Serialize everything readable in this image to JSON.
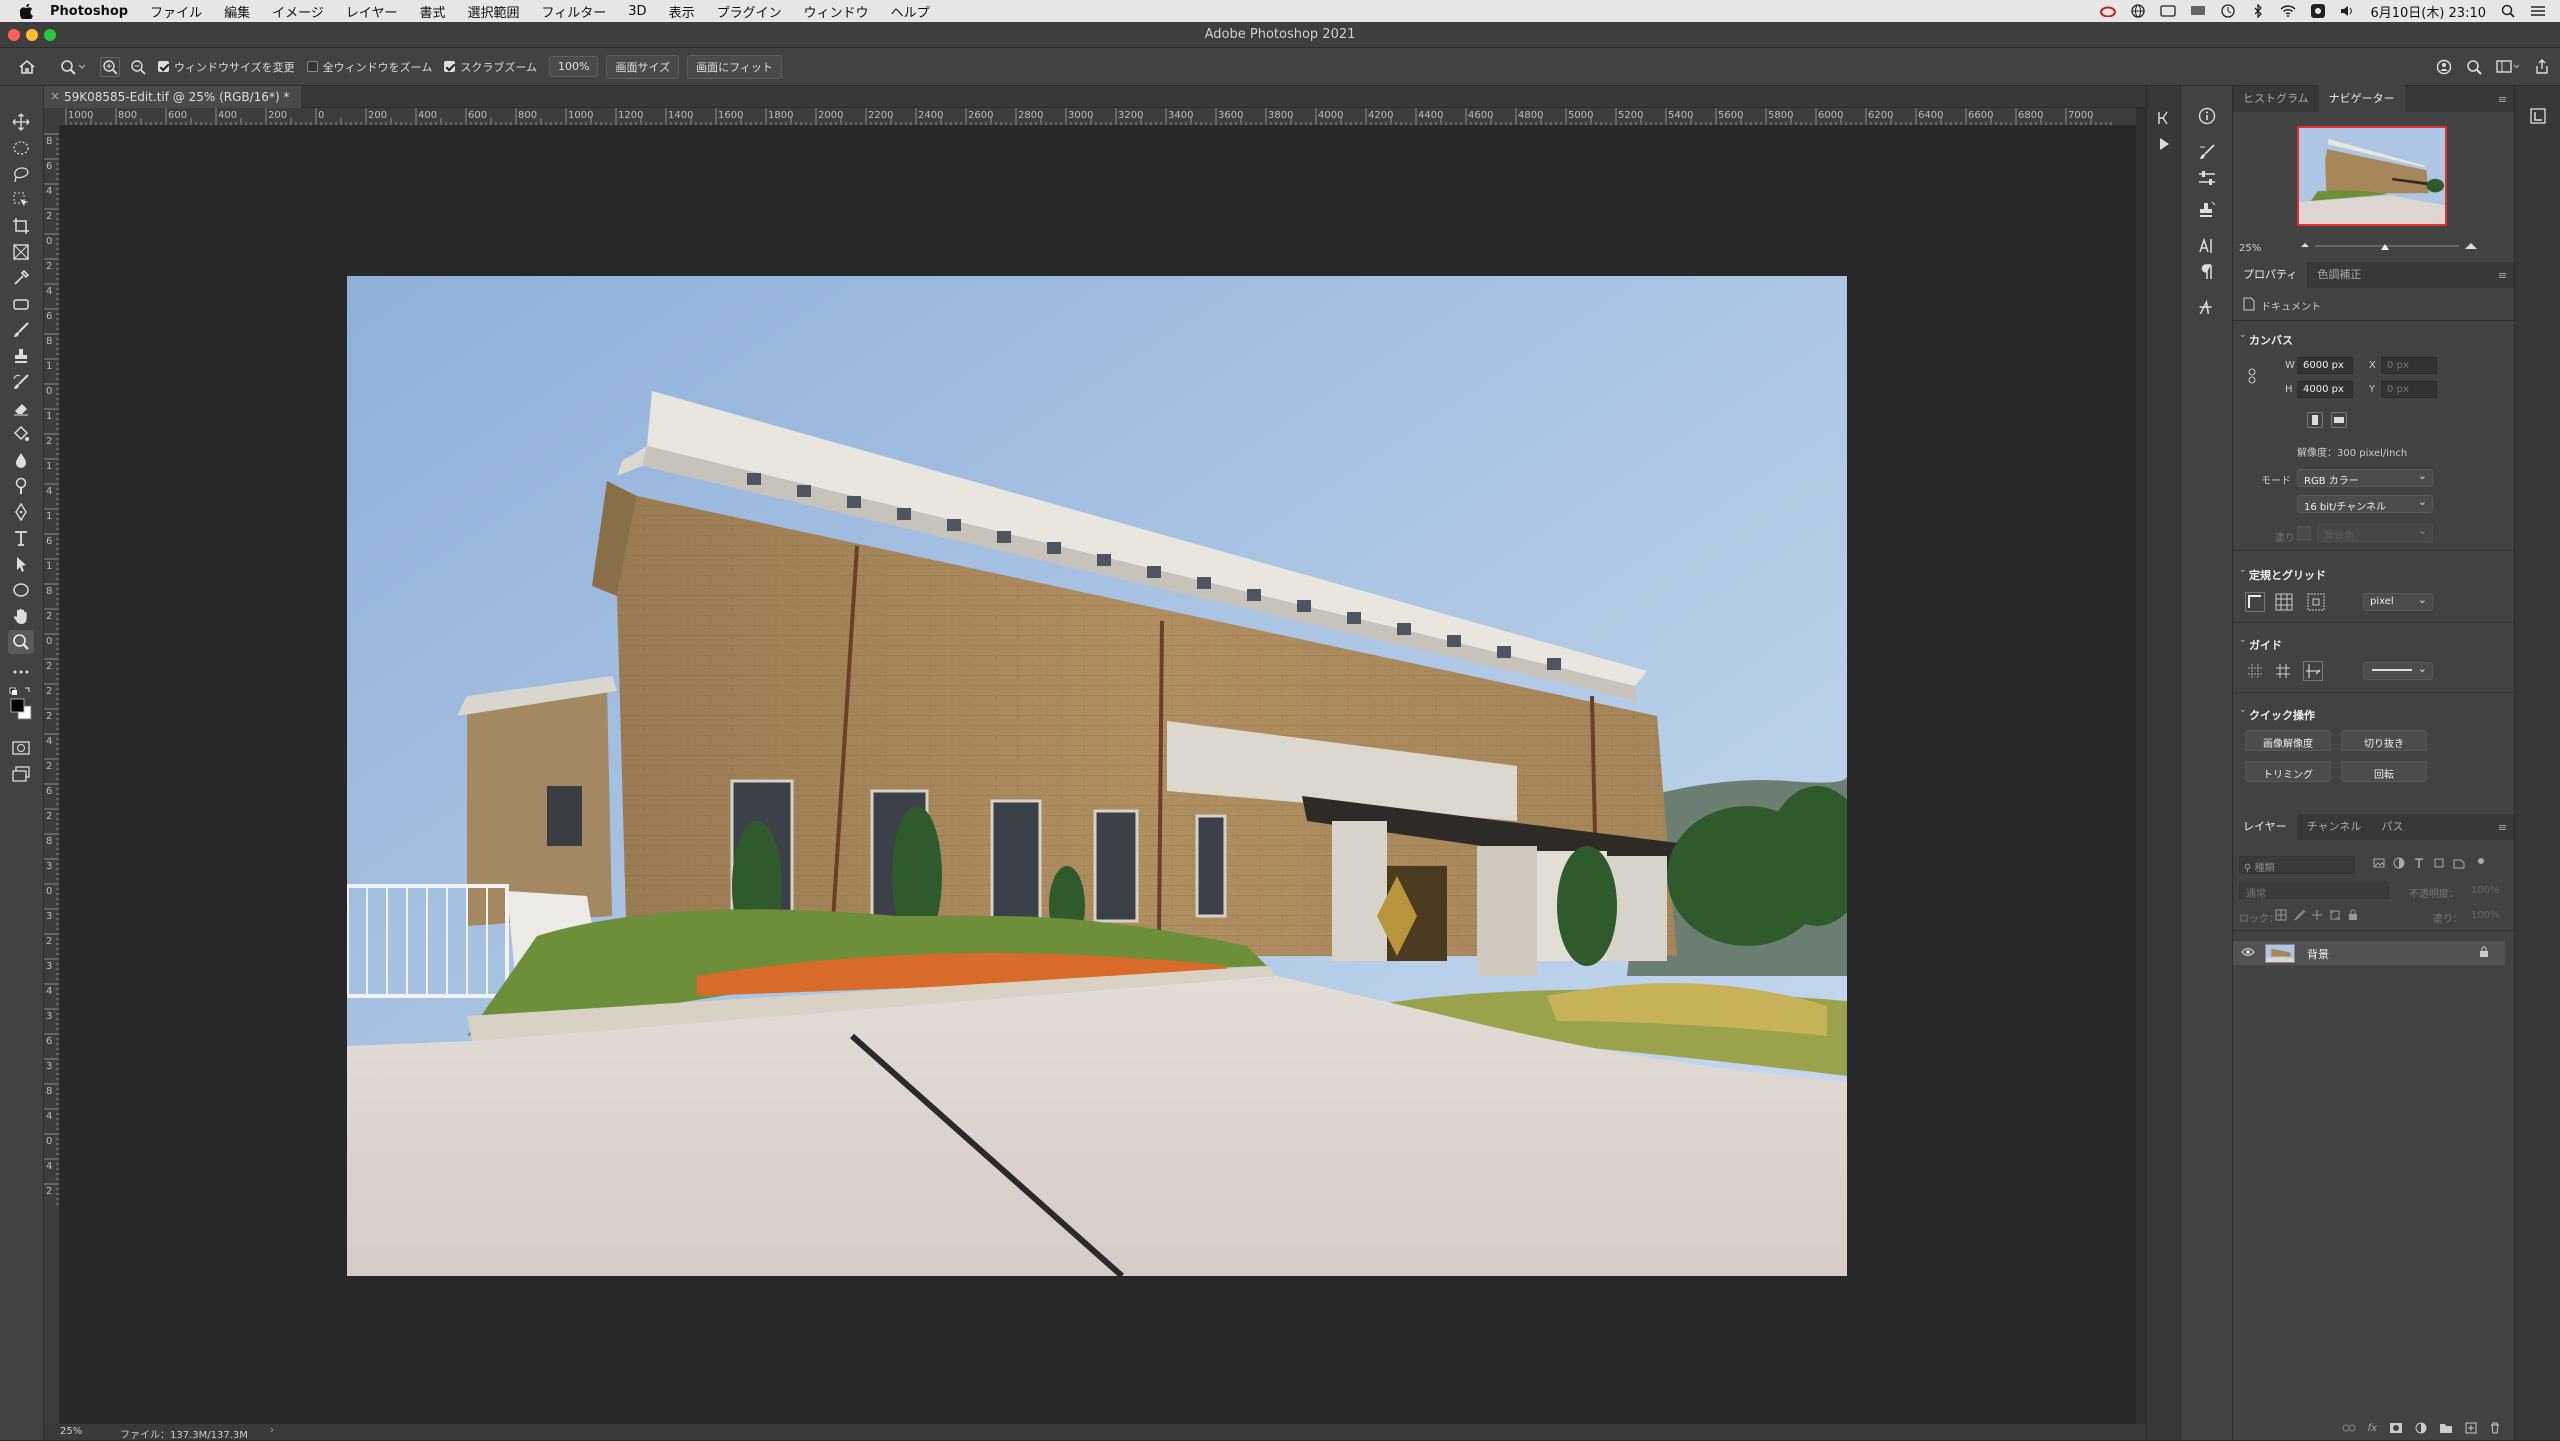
{
  "menubar": {
    "app": "Photoshop",
    "items": [
      "ファイル",
      "編集",
      "イメージ",
      "レイヤー",
      "書式",
      "選択範囲",
      "フィルター",
      "3D",
      "表示",
      "プラグイン",
      "ウィンドウ",
      "ヘルプ"
    ],
    "clock": "6月10日(木) 23:10"
  },
  "window": {
    "title": "Adobe Photoshop 2021"
  },
  "options": {
    "resize_windows": "ウィンドウサイズを変更",
    "zoom_all": "全ウィンドウをズーム",
    "scrubby_zoom": "スクラブズーム",
    "btn_100": "100%",
    "btn_screen_size": "画面サイズ",
    "btn_fit_screen": "画面にフィット"
  },
  "document": {
    "tab_title": "59K08585-Edit.tif @ 25% (RGB/16*) *"
  },
  "ruler": {
    "top": [
      "1000",
      "800",
      "600",
      "400",
      "200",
      "0",
      "200",
      "400",
      "600",
      "800",
      "1000",
      "1200",
      "1400",
      "1600",
      "1800",
      "2000",
      "2200",
      "2400",
      "2600",
      "2800",
      "3000",
      "3200",
      "3400",
      "3600",
      "3800",
      "4000",
      "4200",
      "4400",
      "4600",
      "4800",
      "5000",
      "5200",
      "5400",
      "5600",
      "5800",
      "6000",
      "6200",
      "6400",
      "6600",
      "6800",
      "7000"
    ],
    "left": [
      "8",
      "6",
      "4",
      "2",
      "0",
      "2",
      "4",
      "6",
      "8",
      "1",
      "0",
      "1",
      "2",
      "1",
      "4",
      "1",
      "6",
      "1",
      "8",
      "2",
      "0",
      "2",
      "2",
      "2",
      "4",
      "2",
      "6",
      "2",
      "8",
      "3",
      "0",
      "3",
      "2",
      "3",
      "4",
      "3",
      "6",
      "3",
      "8",
      "4",
      "0",
      "4",
      "2"
    ]
  },
  "status": {
    "zoom": "25%",
    "file": "ファイル：137.3M/137.3M"
  },
  "navigator": {
    "tabs": [
      "ヒストグラム",
      "ナビゲーター"
    ],
    "zoom": "25%"
  },
  "properties": {
    "tabs": [
      "プロパティ",
      "色調補正"
    ],
    "doc_label": "ドキュメント",
    "canvas": {
      "header": "カンバス",
      "w_label": "W",
      "w_value": "6000 px",
      "h_label": "H",
      "h_value": "4000 px",
      "x_label": "X",
      "x_value": "0 px",
      "y_label": "Y",
      "y_value": "0 px",
      "resolution": "解像度：300 pixel/inch",
      "mode_label": "モード",
      "mode_value": "RGB カラー",
      "bit_value": "16 bit/チャンネル",
      "fill_label": "塗り",
      "fill_value": "背景色"
    },
    "rulers_grid": {
      "header": "定規とグリッド",
      "unit": "pixel"
    },
    "guides": {
      "header": "ガイド"
    },
    "quick": {
      "header": "クイック操作",
      "btn_image_size": "画像解像度",
      "btn_crop": "切り抜き",
      "btn_trim": "トリミング",
      "btn_rotate": "回転"
    }
  },
  "layers": {
    "tabs": [
      "レイヤー",
      "チャンネル",
      "パス"
    ],
    "search_placeholder": "種類",
    "blend": "通常",
    "opacity_label": "不透明度：",
    "opacity_value": "100%",
    "lock_label": "ロック：",
    "fill_label": "塗り：",
    "fill_value": "100%",
    "layer_name": "背景"
  },
  "colors": {
    "bg_dark": "#282828",
    "panel": "#424242",
    "accent_nav_box": "#e03030"
  }
}
